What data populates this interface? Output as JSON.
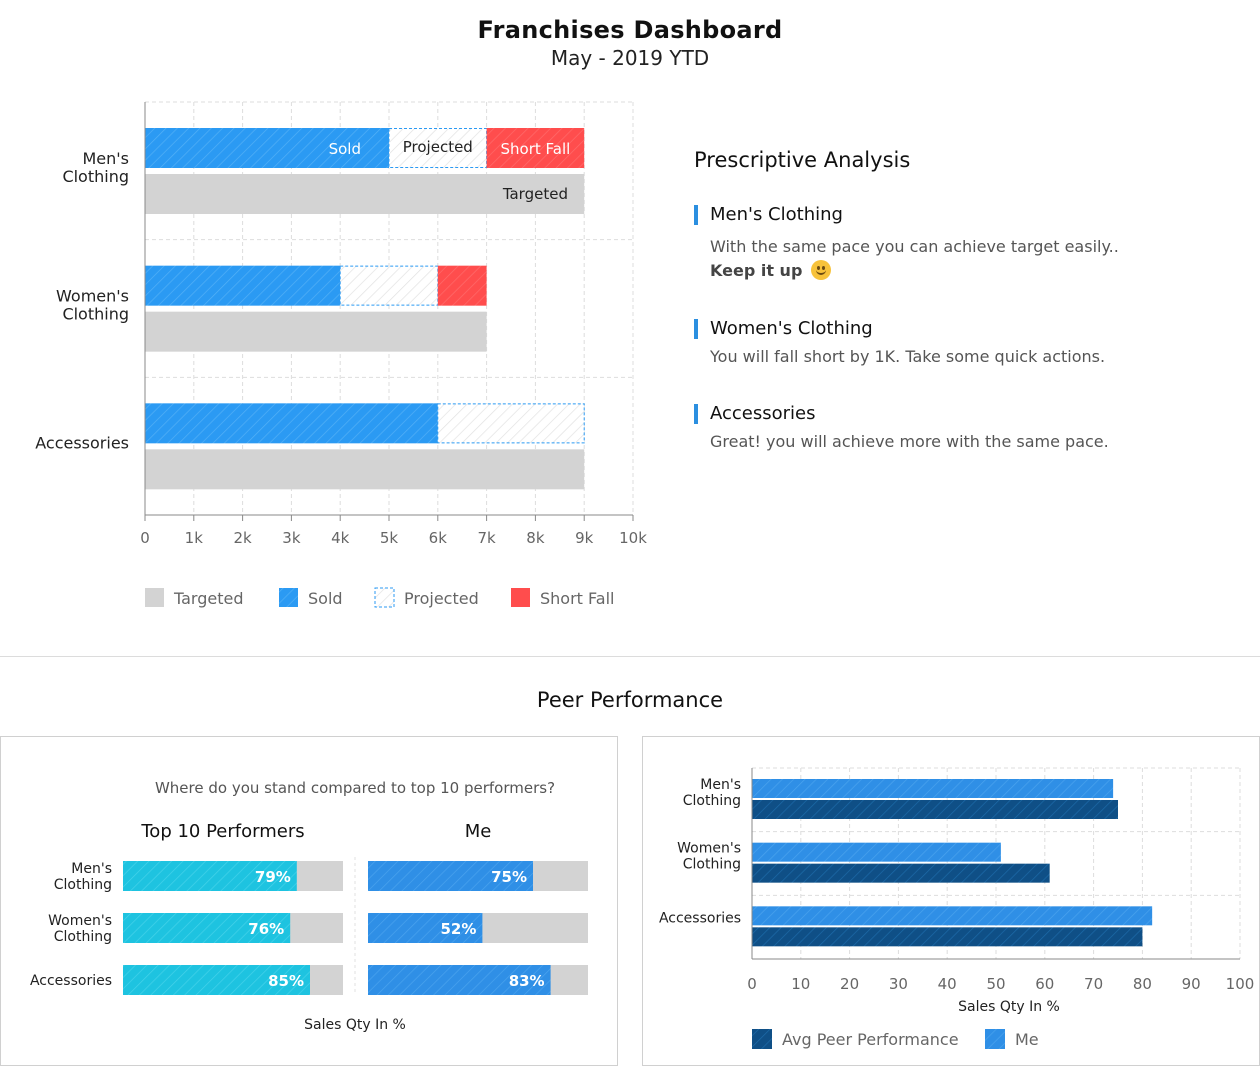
{
  "header": {
    "title": "Franchises Dashboard",
    "subtitle": "May - 2019 YTD"
  },
  "colors": {
    "sold": "#2b9af3",
    "projected_border": "#2b9af3",
    "short_fall": "#ff4d4d",
    "targeted": "#d3d3d3",
    "top10": "#1ec3e0",
    "me": "#2f8fe6",
    "avg_peer": "#0f4f86"
  },
  "chart_data": [
    {
      "type": "bar",
      "orientation": "horizontal",
      "stacked": true,
      "categories": [
        "Men's Clothing",
        "Women's Clothing",
        "Accessories"
      ],
      "series": [
        {
          "name": "Targeted",
          "values": [
            9000,
            7000,
            9000
          ]
        },
        {
          "name": "Sold",
          "values": [
            5000,
            4000,
            6000
          ]
        },
        {
          "name": "Projected",
          "values": [
            2000,
            2000,
            3000
          ]
        },
        {
          "name": "Short Fall",
          "values": [
            2000,
            1000,
            0
          ]
        }
      ],
      "bar_labels": {
        "sold": "Sold",
        "projected": "Projected",
        "short_fall": "Short Fall",
        "targeted": "Targeted"
      },
      "x_ticks": [
        "0",
        "1k",
        "2k",
        "3k",
        "4k",
        "5k",
        "6k",
        "7k",
        "8k",
        "9k",
        "10k"
      ],
      "xlim": [
        0,
        10000
      ],
      "grid": true,
      "legend": [
        "Targeted",
        "Sold",
        "Projected",
        "Short Fall"
      ],
      "legend_position": "bottom"
    },
    {
      "type": "bar",
      "orientation": "horizontal",
      "title": "Where do you stand compared to top 10 performers?",
      "categories": [
        "Men's Clothing",
        "Women's Clothing",
        "Accessories"
      ],
      "panels": [
        {
          "name": "Top 10 Performers",
          "values": [
            79,
            76,
            85
          ],
          "labels": [
            "79%",
            "76%",
            "85%"
          ]
        },
        {
          "name": "Me",
          "values": [
            75,
            52,
            83
          ],
          "labels": [
            "75%",
            "52%",
            "83%"
          ]
        }
      ],
      "xlim": [
        0,
        100
      ],
      "xlabel": "Sales Qty In %"
    },
    {
      "type": "bar",
      "orientation": "horizontal",
      "categories": [
        "Men's Clothing",
        "Women's Clothing",
        "Accessories"
      ],
      "series": [
        {
          "name": "Me",
          "values": [
            74,
            51,
            82
          ]
        },
        {
          "name": "Avg Peer Performance",
          "values": [
            75,
            61,
            80
          ]
        }
      ],
      "x_ticks": [
        "0",
        "10",
        "20",
        "30",
        "40",
        "50",
        "60",
        "70",
        "80",
        "90",
        "100"
      ],
      "xlim": [
        0,
        100
      ],
      "xlabel": "Sales Qty In %",
      "grid": true,
      "legend": [
        "Avg Peer Performance",
        "Me"
      ],
      "legend_position": "bottom"
    }
  ],
  "analysis": {
    "title": "Prescriptive Analysis",
    "items": [
      {
        "heading": "Men's Clothing",
        "text": "With the same pace you can achieve target easily..",
        "bold": "Keep it up"
      },
      {
        "heading": "Women's Clothing",
        "text": "You will  fall short by 1K. Take some quick actions."
      },
      {
        "heading": "Accessories",
        "text": "Great! you will achieve more with the same pace."
      }
    ]
  },
  "peer": {
    "title": "Peer Performance"
  }
}
